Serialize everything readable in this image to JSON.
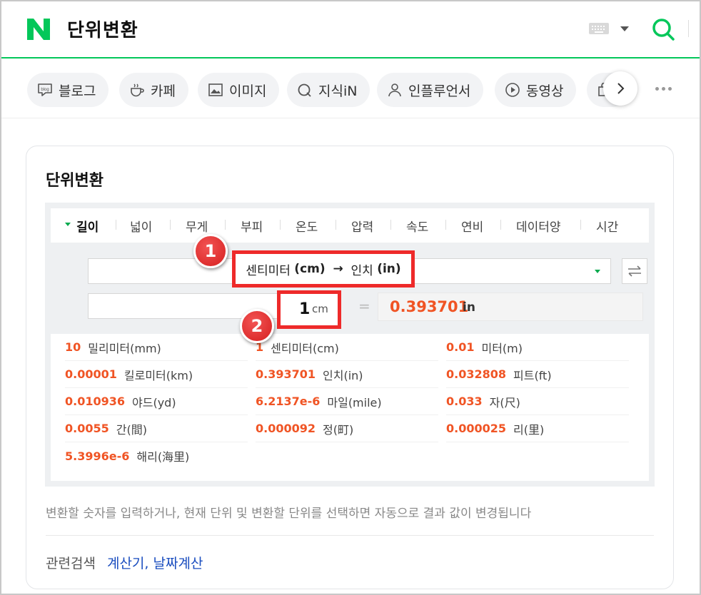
{
  "header": {
    "logo_text": "N",
    "query": "단위변환",
    "brand_color": "#03c75a"
  },
  "tabs": [
    {
      "label": "블로그",
      "icon": "blog-icon"
    },
    {
      "label": "카페",
      "icon": "cafe-cup-icon"
    },
    {
      "label": "이미지",
      "icon": "image-icon"
    },
    {
      "label": "지식iN",
      "icon": "knowledge-icon"
    },
    {
      "label": "인플루언서",
      "icon": "person-icon"
    },
    {
      "label": "동영상",
      "icon": "play-icon"
    }
  ],
  "card": {
    "title": "단위변환",
    "categories": [
      "길이",
      "넓이",
      "무게",
      "부피",
      "온도",
      "압력",
      "속도",
      "연비",
      "데이터양",
      "시간"
    ],
    "active_category": "길이",
    "from_unit": "센티미터",
    "from_abbr": "(cm)",
    "arrow": "→",
    "to_unit": "인치",
    "to_abbr": "(in)",
    "input_value": "1",
    "input_unit": "cm",
    "equals": "=",
    "result_value": "0.393701",
    "result_unit": "in",
    "conversions": [
      {
        "value": "10",
        "name": "밀리미터(mm)"
      },
      {
        "value": "1",
        "name": "센티미터(cm)"
      },
      {
        "value": "0.01",
        "name": "미터(m)"
      },
      {
        "value": "0.00001",
        "name": "킬로미터(km)"
      },
      {
        "value": "0.393701",
        "name": "인치(in)"
      },
      {
        "value": "0.032808",
        "name": "피트(ft)"
      },
      {
        "value": "0.010936",
        "name": "야드(yd)"
      },
      {
        "value": "6.2137e-6",
        "name": "마일(mile)"
      },
      {
        "value": "0.033",
        "name": "자(尺)"
      },
      {
        "value": "0.0055",
        "name": "간(間)"
      },
      {
        "value": "0.000092",
        "name": "정(町)"
      },
      {
        "value": "0.000025",
        "name": "리(里)"
      },
      {
        "value": "5.3996e-6",
        "name": "해리(海里)"
      }
    ],
    "hint": "변환할 숫자를 입력하거나, 현재 단위 및 변환할 단위를 선택하면 자동으로 결과 값이 변경됩니다",
    "related_label": "관련검색",
    "related_links": [
      "계산기",
      "날짜계산"
    ],
    "related_separator": ","
  },
  "annotations": {
    "badge_1": "1",
    "badge_2": "2",
    "highlight_color": "#ee2a2a"
  },
  "colors": {
    "accent": "#03c75a",
    "value_orange": "#f05424",
    "link_blue": "#1a4dbf"
  }
}
